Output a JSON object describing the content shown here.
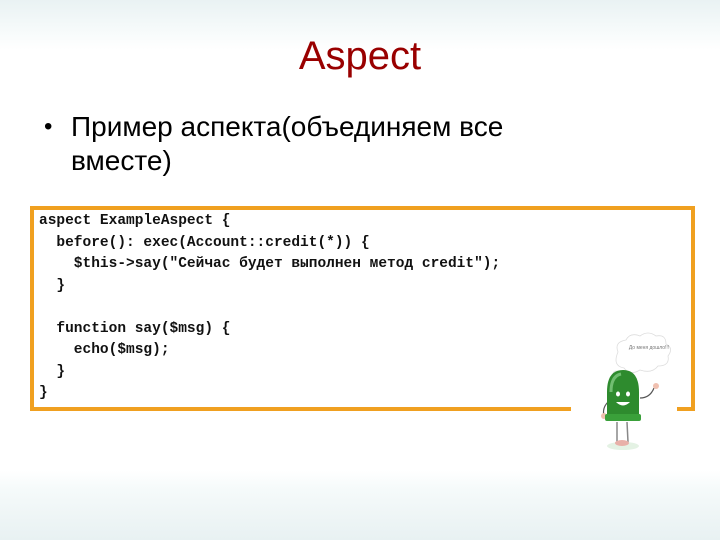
{
  "slide": {
    "title": "Aspect",
    "bullets": [
      {
        "marker": "•",
        "text": "Пример аспекта(объединяем все вместе)"
      }
    ],
    "code_lines": [
      "aspect ExampleAspect {",
      "  before(): exec(Account::credit(*)) {",
      "    $this->say(\"Сейчас будет выполнен метод credit\");",
      "  }",
      "",
      "  function say($msg) {",
      "    echo($msg);",
      "  }",
      "}"
    ],
    "mascot": {
      "icon": "green-led-mascot-icon",
      "thought_bubble_text": "До меня дошло!!!"
    }
  },
  "colors": {
    "title": "#990000",
    "code_border": "#f0a020",
    "text": "#000000"
  }
}
